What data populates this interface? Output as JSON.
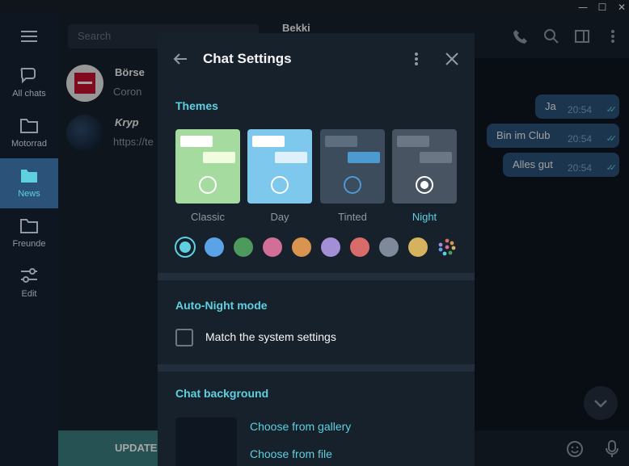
{
  "window": {
    "minimize": "—",
    "maximize": "☐",
    "close": "✕"
  },
  "folders": [
    {
      "label": "All chats",
      "icon": "chat-bubbles-icon",
      "active": false
    },
    {
      "label": "Motorrad",
      "icon": "folder-icon",
      "active": false
    },
    {
      "label": "News",
      "icon": "folder-icon",
      "active": true
    },
    {
      "label": "Freunde",
      "icon": "folder-icon",
      "active": false
    },
    {
      "label": "Edit",
      "icon": "sliders-icon",
      "active": false
    }
  ],
  "chatlist": {
    "search_placeholder": "Search",
    "chats": [
      {
        "name": "Börse",
        "preview": "Coron"
      },
      {
        "name": "Kryp",
        "preview": "https://te"
      }
    ],
    "update_label": "UPDATE"
  },
  "chat": {
    "title": "Bekki",
    "messages": [
      {
        "text": "Ja",
        "time": "20:54"
      },
      {
        "text": "Bin im Club",
        "time": "20:54"
      },
      {
        "text": "Alles gut",
        "time": "20:54"
      }
    ]
  },
  "settings": {
    "title": "Chat Settings",
    "themes_header": "Themes",
    "themes": [
      {
        "label": "Classic",
        "selected": false
      },
      {
        "label": "Day",
        "selected": false
      },
      {
        "label": "Tinted",
        "selected": false
      },
      {
        "label": "Night",
        "selected": true
      }
    ],
    "accent_colors": [
      "#5ed0e0",
      "#5aa3e8",
      "#4c9a5c",
      "#d26f99",
      "#d9954f",
      "#a28fd5",
      "#d96b6b",
      "#7e8a9a",
      "#d6b25e"
    ],
    "auto_night_header": "Auto-Night mode",
    "match_system_label": "Match the system settings",
    "match_system_checked": false,
    "background_header": "Chat background",
    "choose_gallery": "Choose from gallery",
    "choose_file": "Choose from file"
  }
}
